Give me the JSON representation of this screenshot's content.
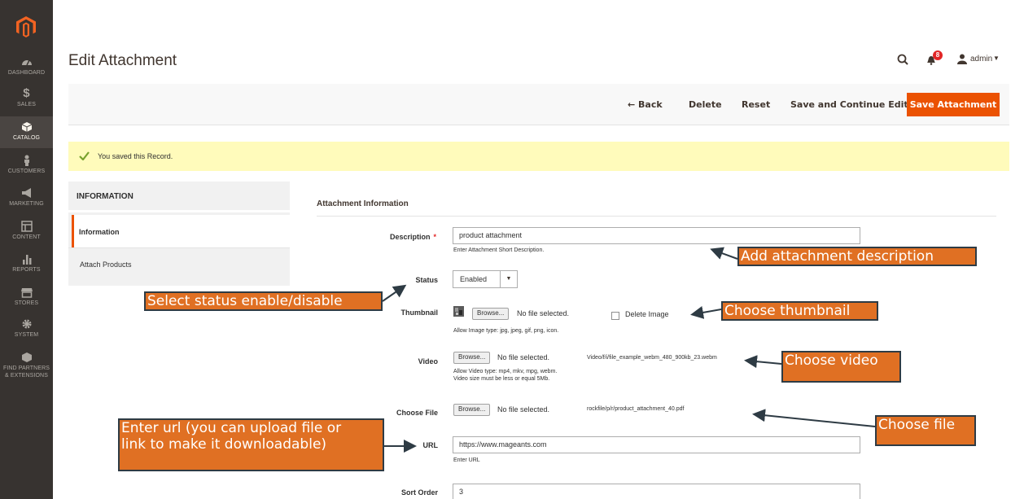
{
  "sidebar": {
    "items": [
      {
        "label": "DASHBOARD",
        "icon": "dashboard-icon"
      },
      {
        "label": "SALES",
        "icon": "dollar-icon"
      },
      {
        "label": "CATALOG",
        "icon": "cube-icon",
        "active": true
      },
      {
        "label": "CUSTOMERS",
        "icon": "person-icon"
      },
      {
        "label": "MARKETING",
        "icon": "megaphone-icon"
      },
      {
        "label": "CONTENT",
        "icon": "layout-icon"
      },
      {
        "label": "REPORTS",
        "icon": "bar-chart-icon"
      },
      {
        "label": "STORES",
        "icon": "store-icon"
      },
      {
        "label": "SYSTEM",
        "icon": "gear-icon"
      },
      {
        "label": "FIND PARTNERS & EXTENSIONS",
        "icon": "box-icon"
      }
    ]
  },
  "header": {
    "title": "Edit Attachment",
    "notification_count": "8",
    "user": "admin"
  },
  "actions": {
    "back": "← Back",
    "delete": "Delete",
    "reset": "Reset",
    "save_continue": "Save and Continue Edit",
    "save": "Save Attachment"
  },
  "message": {
    "text": "You saved this Record."
  },
  "tabs": {
    "header": "INFORMATION",
    "items": [
      "Information",
      "Attach Products"
    ]
  },
  "form": {
    "section_title": "Attachment Information",
    "description": {
      "label": "Description",
      "value": "product attachment",
      "note": "Enter Attachment Short Description."
    },
    "status": {
      "label": "Status",
      "value": "Enabled"
    },
    "thumbnail": {
      "label": "Thumbnail",
      "browse": "Browse...",
      "file_status": "No file selected.",
      "delete_label": "Delete Image",
      "note": "Allow Image type: jpg, jpeg, gif, png, icon."
    },
    "video": {
      "label": "Video",
      "browse": "Browse...",
      "file_status": "No file selected.",
      "path": "Video/f/i/file_example_webm_480_900kb_23.webm",
      "note1": "Allow Video type: mp4, mkv, mpg, webm.",
      "note2": "Video size must be less or equal 5Mb."
    },
    "choose_file": {
      "label": "Choose File",
      "browse": "Browse...",
      "file_status": "No file selected.",
      "path": "rockfile/p/r/product_attachment_40.pdf"
    },
    "url": {
      "label": "URL",
      "value": "https://www.mageants.com",
      "note": "Enter URL"
    },
    "sort_order": {
      "label": "Sort Order",
      "value": "3"
    }
  },
  "callouts": {
    "description": "Add attachment description",
    "status": "Select status enable/disable",
    "thumbnail": "Choose thumbnail",
    "video": "Choose video",
    "file": "Choose file",
    "url_line1": "Enter url (you can upload file or",
    "url_line2": "link to make it downloadable)"
  },
  "colors": {
    "accent": "#eb5202",
    "sidebar": "#373330",
    "callout": "#e07023",
    "message_bg": "#fffbbb"
  }
}
